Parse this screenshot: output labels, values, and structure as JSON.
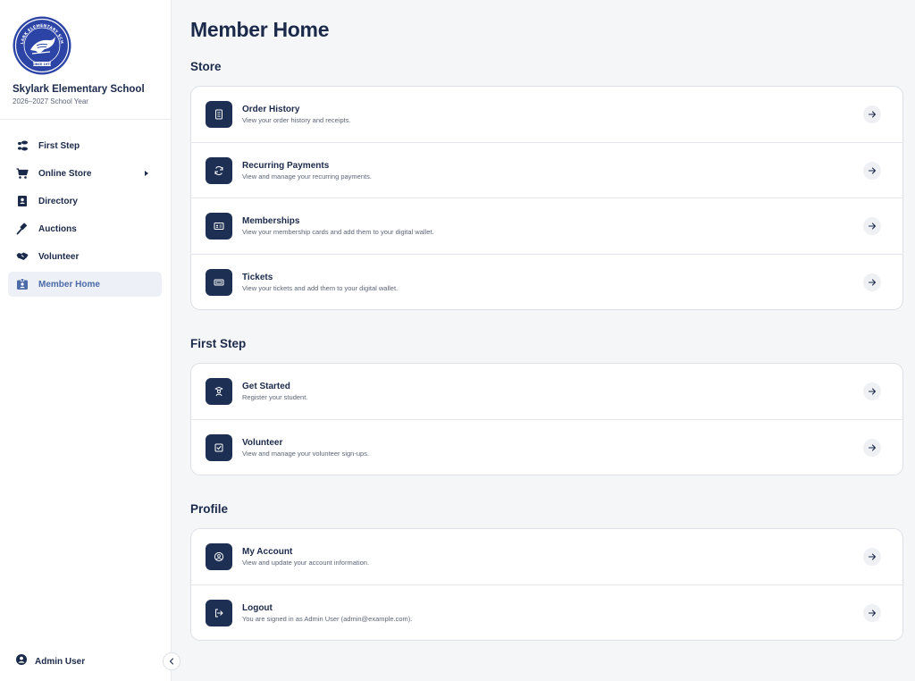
{
  "sidebar": {
    "school_name": "Skylark Elementary School",
    "school_year": "2026–2027 School Year",
    "logo_text_top": "SKYLARK ELEMENTARY SCHOOL",
    "logo_text_bottom": "SINCE 1979",
    "nav": [
      {
        "label": "First Step",
        "icon": "footsteps-icon"
      },
      {
        "label": "Online Store",
        "icon": "cart-icon"
      },
      {
        "label": "Directory",
        "icon": "contact-book-icon"
      },
      {
        "label": "Auctions",
        "icon": "gavel-icon"
      },
      {
        "label": "Volunteer",
        "icon": "handshake-icon"
      },
      {
        "label": "Member Home",
        "icon": "id-badge-icon",
        "active": true
      }
    ],
    "user": "Admin User"
  },
  "main": {
    "title": "Member Home",
    "sections": [
      {
        "title": "Store",
        "rows": [
          {
            "title": "Order History",
            "desc": "View your order history and receipts.",
            "icon": "receipt-icon"
          },
          {
            "title": "Recurring Payments",
            "desc": "View and manage your recurring payments.",
            "icon": "refresh-icon"
          },
          {
            "title": "Memberships",
            "desc": "View your membership cards and add them to your digital wallet.",
            "icon": "id-card-icon"
          },
          {
            "title": "Tickets",
            "desc": "View your tickets and add them to your digital wallet.",
            "icon": "ticket-icon"
          }
        ]
      },
      {
        "title": "First Step",
        "rows": [
          {
            "title": "Get Started",
            "desc": "Register your student.",
            "icon": "student-icon"
          },
          {
            "title": "Volunteer",
            "desc": "View and manage your volunteer sign-ups.",
            "icon": "checkbox-icon"
          }
        ]
      },
      {
        "title": "Profile",
        "rows": [
          {
            "title": "My Account",
            "desc": "View and update your account information.",
            "icon": "user-circle-icon"
          },
          {
            "title": "Logout",
            "desc": "You are signed in as Admin User (admin@example.com).",
            "icon": "logout-icon"
          }
        ]
      }
    ]
  },
  "colors": {
    "navy": "#1d2f52",
    "accent": "#4a6aa8",
    "background": "#f5f6f8"
  }
}
